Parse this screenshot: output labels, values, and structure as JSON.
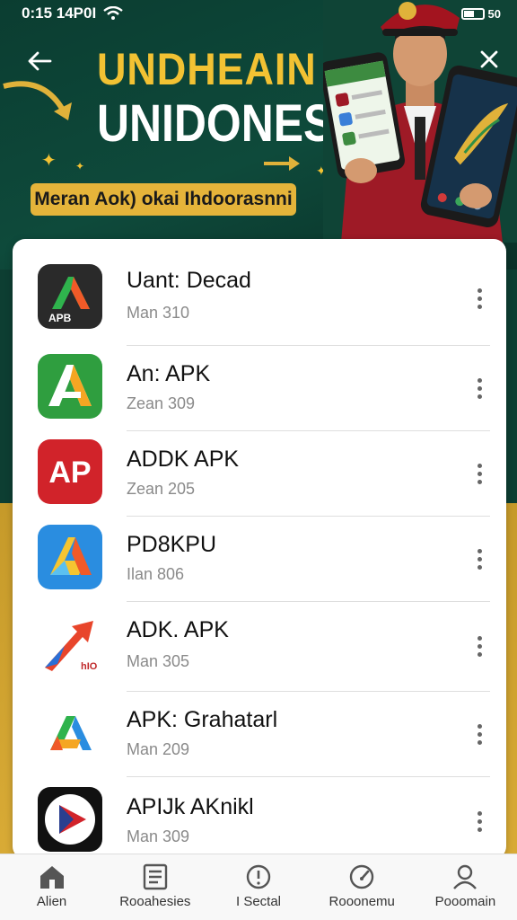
{
  "status_bar": {
    "time": "0:15 14P0I",
    "battery_text": "50"
  },
  "hero": {
    "title_line1": "UNDHEAIN",
    "title_line2": "UNIDONESIA",
    "banner": "Meran Aok) okai Ihdoorasnni"
  },
  "apps": [
    {
      "name": "Uant: Decad",
      "sub": "Man 310",
      "icon": "app-icon-a-dark"
    },
    {
      "name": "An: APK",
      "sub": "Zean 309",
      "icon": "app-icon-a-green"
    },
    {
      "name": "ADDK APK",
      "sub": "Zean 205",
      "icon": "app-icon-ap-red"
    },
    {
      "name": "PD8KPU",
      "sub": "Ilan 806",
      "icon": "app-icon-a-blue"
    },
    {
      "name": "ADK. APK",
      "sub": "Man 305",
      "icon": "app-icon-arrow-red"
    },
    {
      "name": "APK: Grahatarl",
      "sub": "Man 209",
      "icon": "app-icon-a-multicolor"
    },
    {
      "name": "APIJk AKnikl",
      "sub": "Man 309",
      "icon": "app-icon-play"
    }
  ],
  "nav": [
    {
      "label": "Alien",
      "icon": "home-icon"
    },
    {
      "label": "Rooahesies",
      "icon": "document-icon"
    },
    {
      "label": "I Sectal",
      "icon": "info-icon"
    },
    {
      "label": "Rooonemu",
      "icon": "gauge-icon"
    },
    {
      "label": "Pooomain",
      "icon": "person-icon"
    }
  ],
  "colors": {
    "accent_gold": "#f2c233",
    "hero_green": "#0e4a3b",
    "gold_band": "#d9ab36"
  }
}
